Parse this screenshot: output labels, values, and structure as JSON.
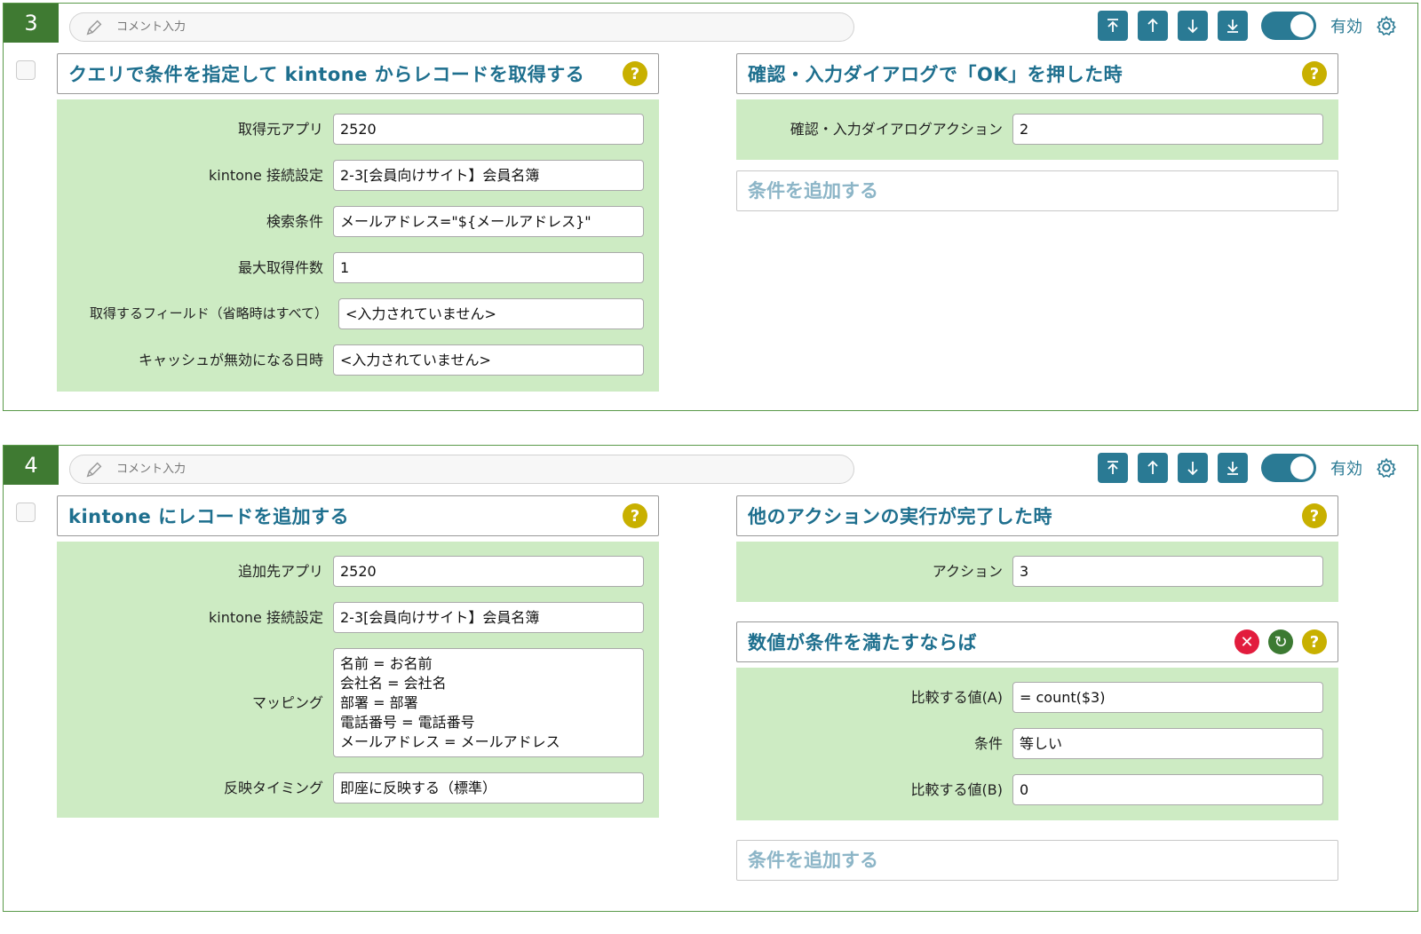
{
  "blocks": [
    {
      "number": "3",
      "comment_placeholder": "コメント入力",
      "enabled_label": "有効",
      "action": {
        "title": "クエリで条件を指定して kintone からレコードを取得する",
        "help": "?",
        "fields": [
          {
            "label": "取得元アプリ",
            "value": "2520"
          },
          {
            "label": "kintone 接続設定",
            "value": "2-3[会員向けサイト】会員名簿"
          },
          {
            "label": "検索条件",
            "value": "メールアドレス=\"${メールアドレス}\""
          },
          {
            "label": "最大取得件数",
            "value": "1"
          },
          {
            "label": "取得するフィールド（省略時はすべて）",
            "value": "<入力されていません>"
          },
          {
            "label": "キャッシュが無効になる日時",
            "value": "<入力されていません>"
          }
        ]
      },
      "trigger": {
        "title": "確認・入力ダイアログで「OK」を押した時",
        "help": "?",
        "fields": [
          {
            "label": "確認・入力ダイアログアクション",
            "value": "2"
          }
        ]
      },
      "add_condition_label": "条件を追加する"
    },
    {
      "number": "4",
      "comment_placeholder": "コメント入力",
      "enabled_label": "有効",
      "action": {
        "title": "kintone にレコードを追加する",
        "help": "?",
        "fields": [
          {
            "label": "追加先アプリ",
            "value": "2520"
          },
          {
            "label": "kintone 接続設定",
            "value": "2-3[会員向けサイト】会員名簿"
          },
          {
            "label": "マッピング",
            "value": "名前 = お名前\n会社名 = 会社名\n部署 = 部署\n電話番号 = 電話番号\nメールアドレス = メールアドレス"
          },
          {
            "label": "反映タイミング",
            "value": "即座に反映する（標準）"
          }
        ]
      },
      "trigger": {
        "title": "他のアクションの実行が完了した時",
        "help": "?",
        "fields": [
          {
            "label": "アクション",
            "value": "3"
          }
        ]
      },
      "condition": {
        "title": "数値が条件を満たすならば",
        "delete": "✕",
        "rotate": "↻",
        "help": "?",
        "fields": [
          {
            "label": "比較する値(A)",
            "value": "= count($3)"
          },
          {
            "label": "条件",
            "value": "等しい"
          },
          {
            "label": "比較する値(B)",
            "value": "0"
          }
        ]
      },
      "add_condition_label": "条件を追加する"
    }
  ],
  "icons": {
    "move_top": "arrow-to-top-icon",
    "move_up": "arrow-up-icon",
    "move_down": "arrow-down-icon",
    "move_bottom": "arrow-to-bottom-icon",
    "settings": "gear-icon",
    "comment": "pencil-icon"
  },
  "colors": {
    "block_number_bg": "#3f7a32",
    "accent": "#2a7a94",
    "title_text": "#1e6f8e",
    "panel_bg": "#cdebc3",
    "help_bg": "#c8b000",
    "delete_bg": "#e21c3d"
  }
}
